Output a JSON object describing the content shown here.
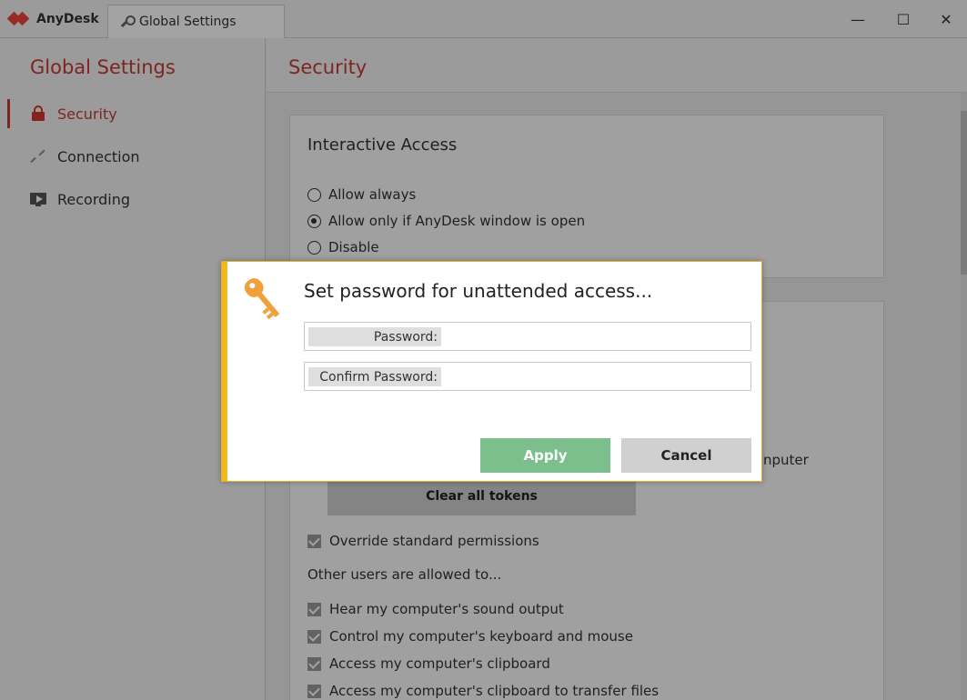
{
  "titlebar": {
    "app_name": "AnyDesk",
    "tab_label": "Global Settings",
    "minimize": "—",
    "maximize": "☐",
    "close": "✕"
  },
  "sidebar": {
    "title": "Global Settings",
    "items": [
      {
        "label": "Security",
        "icon": "lock-icon",
        "active": true
      },
      {
        "label": "Connection",
        "icon": "connection-icon",
        "active": false
      },
      {
        "label": "Recording",
        "icon": "recording-icon",
        "active": false
      }
    ]
  },
  "main": {
    "title": "Security",
    "interactive_access": {
      "title": "Interactive Access",
      "options": [
        {
          "label": "Allow always",
          "selected": false
        },
        {
          "label": "Allow only if AnyDesk window is open",
          "selected": true
        },
        {
          "label": "Disable",
          "selected": false
        }
      ]
    },
    "unattended": {
      "partial_text": "nputer",
      "clear_tokens_label": "Clear all tokens"
    },
    "permissions": {
      "override_label": "Override standard permissions",
      "override_checked": true,
      "others_label": "Other users are allowed to...",
      "items": [
        {
          "label": "Hear my computer's sound output",
          "checked": true
        },
        {
          "label": "Control my computer's keyboard and mouse",
          "checked": true
        },
        {
          "label": "Access my computer's clipboard",
          "checked": true
        },
        {
          "label": "Access my computer's clipboard to transfer files",
          "checked": true
        }
      ]
    }
  },
  "dialog": {
    "title": "Set password for unattended access...",
    "password_label": "Password:",
    "password_value": "",
    "confirm_label": "Confirm Password:",
    "confirm_value": "",
    "apply_label": "Apply",
    "cancel_label": "Cancel",
    "accent_color": "#f3b81f",
    "apply_color": "#7dbf8c"
  }
}
